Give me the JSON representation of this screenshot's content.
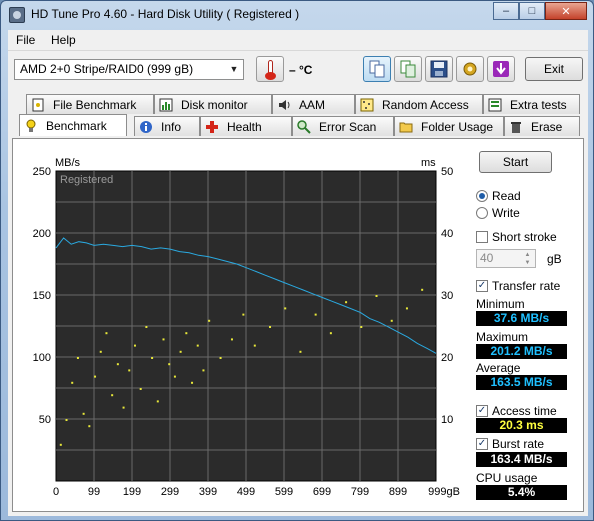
{
  "window": {
    "title": "HD Tune Pro 4.60 - Hard Disk Utility (  Registered )",
    "caption_minimize": "‒",
    "caption_maximize": "□",
    "caption_close": "✕"
  },
  "menu": {
    "file": "File",
    "help": "Help"
  },
  "toolbar": {
    "drive": "AMD     2+0 Stripe/RAID0 (999 gB)",
    "temperature": "– °C",
    "exit_label": "Exit",
    "icons": [
      "copy-icon",
      "copy-text-icon",
      "save-icon",
      "options-icon",
      "download-icon"
    ]
  },
  "tabs": {
    "row1": [
      "File Benchmark",
      "Disk monitor",
      "AAM",
      "Random Access",
      "Extra tests"
    ],
    "row2": [
      "Benchmark",
      "Info",
      "Health",
      "Error Scan",
      "Folder Usage",
      "Erase"
    ],
    "selected": "Benchmark"
  },
  "controls": {
    "start_label": "Start",
    "read_label": "Read",
    "write_label": "Write",
    "mode": "Read",
    "short_stroke_label": "Short stroke",
    "short_stroke_checked": false,
    "short_stroke_value": "40",
    "short_stroke_unit": "gB",
    "transfer_rate_label": "Transfer rate",
    "transfer_rate_checked": true,
    "access_time_label": "Access time",
    "access_time_checked": true,
    "burst_rate_label": "Burst rate",
    "burst_rate_checked": true
  },
  "results": {
    "minimum_label": "Minimum",
    "minimum": "37.6 MB/s",
    "maximum_label": "Maximum",
    "maximum": "201.2 MB/s",
    "average_label": "Average",
    "average": "163.5 MB/s",
    "access_time": "20.3 ms",
    "burst_rate": "163.4 MB/s",
    "cpu_usage_label": "CPU usage",
    "cpu_usage": "5.4%"
  },
  "chart_data": {
    "type": "line",
    "watermark": "Registered",
    "y_left_unit": "MB/s",
    "y_right_unit": "ms",
    "ylim_left": [
      0,
      250
    ],
    "ylim_right": [
      0,
      50
    ],
    "xlim": [
      0,
      999
    ],
    "y_left_ticks": [
      "250",
      "200",
      "150",
      "100",
      "50"
    ],
    "y_right_ticks": [
      "50",
      "40",
      "30",
      "20",
      "10"
    ],
    "x_ticks": [
      "0",
      "99",
      "199",
      "299",
      "399",
      "499",
      "599",
      "699",
      "799",
      "899",
      "999gB"
    ],
    "grid": true,
    "series": [
      {
        "color": "#2aa9e0",
        "x": [
          0,
          20,
          40,
          60,
          80,
          100,
          125,
          150,
          175,
          200,
          225,
          250,
          275,
          300,
          325,
          350,
          375,
          400,
          425,
          450,
          475,
          500,
          525,
          550,
          575,
          600,
          625,
          650,
          675,
          700,
          725,
          750,
          775,
          800,
          825,
          850,
          875,
          900,
          925,
          950,
          975,
          999
        ],
        "y": [
          188,
          196,
          191,
          193,
          192,
          190,
          191,
          190,
          189,
          190,
          189,
          187,
          188,
          187,
          185,
          184,
          182,
          181,
          179,
          177,
          175,
          172,
          169,
          166,
          163,
          160,
          157,
          154,
          151,
          148,
          145,
          142,
          139,
          136,
          131,
          128,
          124,
          120,
          116,
          111,
          107,
          103
        ]
      },
      {
        "color": "#e8e83a",
        "description_of_marks": "access time scatter",
        "x": [
          10,
          25,
          40,
          55,
          70,
          85,
          100,
          115,
          130,
          145,
          160,
          175,
          190,
          205,
          220,
          235,
          250,
          265,
          280,
          295,
          310,
          325,
          340,
          355,
          370,
          385,
          400,
          430,
          460,
          490,
          520,
          560,
          600,
          640,
          680,
          720,
          760,
          800,
          840,
          880,
          920,
          960
        ],
        "y": [
          6,
          10,
          16,
          20,
          11,
          9,
          17,
          21,
          24,
          14,
          19,
          12,
          18,
          22,
          15,
          25,
          20,
          13,
          23,
          19,
          17,
          21,
          24,
          16,
          22,
          18,
          26,
          20,
          23,
          27,
          22,
          25,
          28,
          21,
          27,
          24,
          29,
          25,
          30,
          26,
          28,
          31
        ]
      }
    ]
  }
}
